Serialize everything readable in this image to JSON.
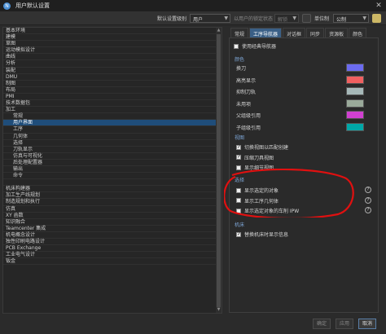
{
  "window": {
    "title": "用户默认设置"
  },
  "toolbar": {
    "level_label": "默认设置级别",
    "level_value": "用户",
    "lock_label": "以用户的锁定状态",
    "lock_value": "解锁",
    "unit_label": "单位制",
    "unit_value": "公制"
  },
  "tree": {
    "items": [
      {
        "label": "基本环境",
        "child": false
      },
      {
        "label": "建模",
        "child": false
      },
      {
        "label": "草图",
        "child": false
      },
      {
        "label": "运动模拟设计",
        "child": false
      },
      {
        "label": "曲线",
        "child": false
      },
      {
        "label": "分析",
        "child": false
      },
      {
        "label": "装配",
        "child": false
      },
      {
        "label": "DMU",
        "child": false
      },
      {
        "label": "制图",
        "child": false
      },
      {
        "label": "布局",
        "child": false
      },
      {
        "label": "PMI",
        "child": false
      },
      {
        "label": "技术数据包",
        "child": false
      },
      {
        "label": "加工",
        "child": false
      },
      {
        "label": "常规",
        "child": true
      },
      {
        "label": "用户界面",
        "child": true
      },
      {
        "label": "工序",
        "child": true
      },
      {
        "label": "几何体",
        "child": true
      },
      {
        "label": "选择",
        "child": true
      },
      {
        "label": "刀轨显示",
        "child": true
      },
      {
        "label": "仿真与可视化",
        "child": true
      },
      {
        "label": "后处理配置器",
        "child": true
      },
      {
        "label": "输出",
        "child": true
      },
      {
        "label": "命令",
        "child": true
      },
      {
        "label": "",
        "child": false
      },
      {
        "label": "机床构建器",
        "child": false
      },
      {
        "label": "加工生产线规划",
        "child": false
      },
      {
        "label": "制造规划和执行",
        "child": false
      },
      {
        "label": "仿真",
        "child": false
      },
      {
        "label": "XY 函数",
        "child": false
      },
      {
        "label": "知识融合",
        "child": false
      },
      {
        "label": "Teamcenter 集成",
        "child": false
      },
      {
        "label": "机电概念设计",
        "child": false
      },
      {
        "label": "独性印刷电路设计",
        "child": false
      },
      {
        "label": "PCB Exchange",
        "child": false
      },
      {
        "label": "工业电气设计",
        "child": false
      },
      {
        "label": "钣金",
        "child": false
      }
    ],
    "selected_index": 14
  },
  "tabs": [
    "常规",
    "工序导航器",
    "对话框",
    "同步",
    "资源板",
    "颜色"
  ],
  "active_tab": 1,
  "panel": {
    "classic_nav_label": "使用经典导航器",
    "color_section": "颜色",
    "colors": [
      {
        "label": "换刀",
        "color": "#6b6bf0"
      },
      {
        "label": "高亮显示",
        "color": "#f06060"
      },
      {
        "label": "抑制刀轨",
        "color": "#a6b8b8"
      },
      {
        "label": "未用项",
        "color": "#9aaa9a"
      },
      {
        "label": "父组级引用",
        "color": "#d040d0"
      },
      {
        "label": "子组级引用",
        "color": "#00a8a8"
      }
    ],
    "view_section": "视图",
    "view_items": [
      {
        "label": "切换视图以匹配创建",
        "checked": true
      },
      {
        "label": "压缩刀具视图",
        "checked": true
      },
      {
        "label": "显示细节视图",
        "checked": false
      }
    ],
    "select_section": "选择",
    "select_items": [
      {
        "label": "显示选定的对象",
        "checked": false
      },
      {
        "label": "显示工序几何体",
        "checked": false
      },
      {
        "label": "显示选定对象的车削 IPW",
        "checked": false
      }
    ],
    "machine_section": "机床",
    "machine_items": [
      {
        "label": "替换机床时显示信息",
        "checked": true
      }
    ]
  },
  "buttons": {
    "ok": "确定",
    "apply": "应用",
    "cancel": "取消"
  }
}
